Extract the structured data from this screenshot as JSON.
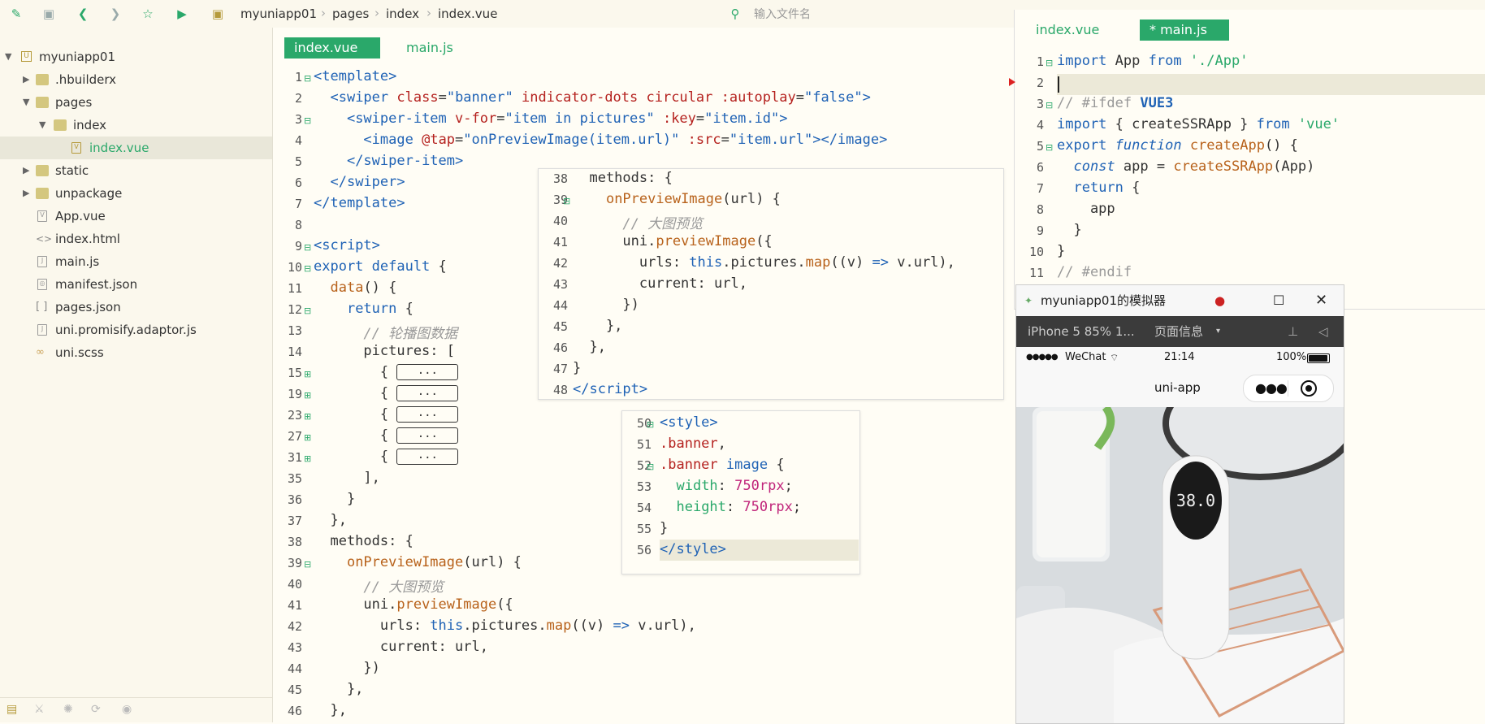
{
  "toolbar": {
    "breadcrumb": [
      "myuniapp01",
      "pages",
      "index",
      "index.vue"
    ],
    "file_search_placeholder": "输入文件名"
  },
  "sidebar": {
    "items": [
      {
        "label": "myuniapp01",
        "type": "project",
        "expanded": true
      },
      {
        "label": ".hbuilderx",
        "type": "folder",
        "expanded": false
      },
      {
        "label": "pages",
        "type": "folder",
        "expanded": true
      },
      {
        "label": "index",
        "type": "folder",
        "expanded": true
      },
      {
        "label": "index.vue",
        "type": "vue-file",
        "selected": true
      },
      {
        "label": "static",
        "type": "folder",
        "expanded": false
      },
      {
        "label": "unpackage",
        "type": "folder",
        "expanded": false
      },
      {
        "label": "App.vue",
        "type": "vue-file"
      },
      {
        "label": "index.html",
        "type": "html-file"
      },
      {
        "label": "main.js",
        "type": "js-file"
      },
      {
        "label": "manifest.json",
        "type": "json-file"
      },
      {
        "label": "pages.json",
        "type": "json-file"
      },
      {
        "label": "uni.promisify.adaptor.js",
        "type": "js-file"
      },
      {
        "label": "uni.scss",
        "type": "scss-file"
      }
    ]
  },
  "editor": {
    "tabs": [
      {
        "label": "index.vue",
        "active": true
      },
      {
        "label": "main.js",
        "active": false
      }
    ],
    "line_numbers": [
      "1",
      "2",
      "3",
      "4",
      "5",
      "6",
      "7",
      "8",
      "9",
      "10",
      "11",
      "12",
      "13",
      "14",
      "15",
      "19",
      "23",
      "27",
      "31",
      "35",
      "36",
      "37",
      "38",
      "39",
      "40",
      "41",
      "42",
      "43",
      "44",
      "45",
      "46"
    ],
    "collapsed_label": "..."
  },
  "peek_script": {
    "line_numbers": [
      "38",
      "39",
      "40",
      "41",
      "42",
      "43",
      "44",
      "45",
      "46",
      "47",
      "48"
    ]
  },
  "peek_style": {
    "line_numbers": [
      "50",
      "51",
      "52",
      "53",
      "54",
      "55",
      "56"
    ]
  },
  "right_editor": {
    "tabs": [
      {
        "label": "index.vue",
        "active": false
      },
      {
        "label": "* main.js",
        "active": true
      }
    ],
    "line_numbers": [
      "1",
      "2",
      "3",
      "4",
      "5",
      "6",
      "7",
      "8",
      "9",
      "10",
      "11"
    ]
  },
  "simulator": {
    "title": "myuniapp01的模拟器",
    "device": "iPhone 5 85% 1...",
    "page_info": "页面信息",
    "carrier": "WeChat",
    "time": "21:14",
    "battery": "100%",
    "nav_title": "uni-app",
    "thermometer_reading": "38.0"
  }
}
